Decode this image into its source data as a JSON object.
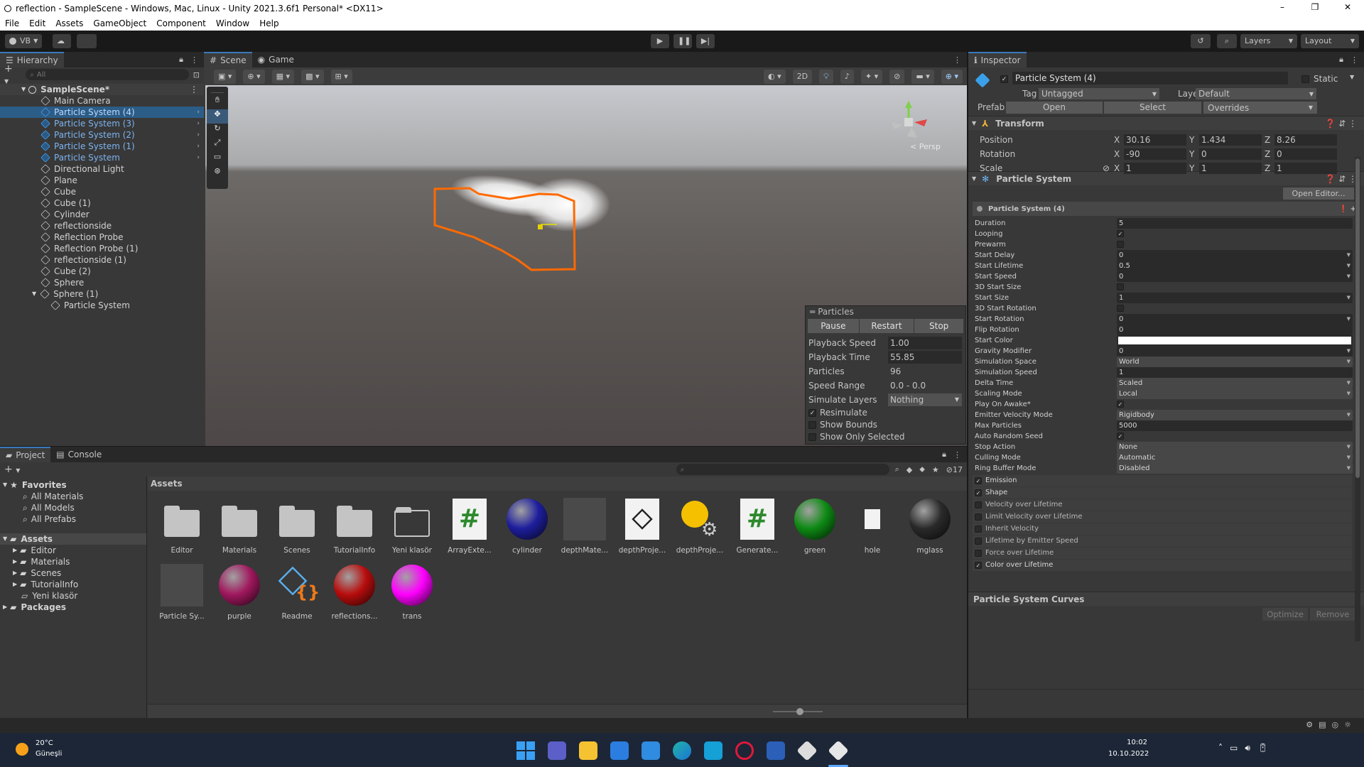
{
  "window": {
    "title": "reflection - SampleScene - Windows, Mac, Linux - Unity 2021.3.6f1 Personal* <DX11>"
  },
  "menu": [
    "File",
    "Edit",
    "Assets",
    "GameObject",
    "Component",
    "Window",
    "Help"
  ],
  "toolbar": {
    "account": "VB",
    "layers": "Layers",
    "layout": "Layout"
  },
  "hierarchy": {
    "tab": "Hierarchy",
    "search_placeholder": "All",
    "scene": "SampleScene*",
    "items": [
      {
        "label": "Main Camera",
        "indent": 1,
        "sel": false,
        "blue": false
      },
      {
        "label": "Particle System (4)",
        "indent": 1,
        "sel": true,
        "blue": true
      },
      {
        "label": "Particle System (3)",
        "indent": 1,
        "sel": false,
        "blue": true
      },
      {
        "label": "Particle System (2)",
        "indent": 1,
        "sel": false,
        "blue": true
      },
      {
        "label": "Particle System (1)",
        "indent": 1,
        "sel": false,
        "blue": true
      },
      {
        "label": "Particle System",
        "indent": 1,
        "sel": false,
        "blue": true
      },
      {
        "label": "Directional Light",
        "indent": 1,
        "sel": false,
        "blue": false
      },
      {
        "label": "Plane",
        "indent": 1,
        "sel": false,
        "blue": false
      },
      {
        "label": "Cube",
        "indent": 1,
        "sel": false,
        "blue": false
      },
      {
        "label": "Cube (1)",
        "indent": 1,
        "sel": false,
        "blue": false
      },
      {
        "label": "Cylinder",
        "indent": 1,
        "sel": false,
        "blue": false
      },
      {
        "label": "reflectionside",
        "indent": 1,
        "sel": false,
        "blue": false
      },
      {
        "label": "Reflection Probe",
        "indent": 1,
        "sel": false,
        "blue": false
      },
      {
        "label": "Reflection Probe (1)",
        "indent": 1,
        "sel": false,
        "blue": false
      },
      {
        "label": "reflectionside (1)",
        "indent": 1,
        "sel": false,
        "blue": false
      },
      {
        "label": "Cube (2)",
        "indent": 1,
        "sel": false,
        "blue": false
      },
      {
        "label": "Sphere",
        "indent": 1,
        "sel": false,
        "blue": false
      },
      {
        "label": "Sphere (1)",
        "indent": 1,
        "sel": false,
        "blue": false
      },
      {
        "label": "Particle System",
        "indent": 2,
        "sel": false,
        "blue": false
      }
    ]
  },
  "scene": {
    "tab_scene": "Scene",
    "tab_game": "Game",
    "btn_2d": "2D",
    "persp": "< Persp"
  },
  "particles_panel": {
    "title": "Particles",
    "pause": "Pause",
    "restart": "Restart",
    "stop": "Stop",
    "rows": [
      {
        "k": "Playback Speed",
        "v": "1.00"
      },
      {
        "k": "Playback Time",
        "v": "55.85"
      },
      {
        "k": "Particles",
        "v": "96"
      },
      {
        "k": "Speed Range",
        "v": "0.0 - 0.0"
      },
      {
        "k": "Simulate Layers",
        "v": "Nothing"
      }
    ],
    "resimulate": "Resimulate",
    "show_bounds": "Show Bounds",
    "show_only_selected": "Show Only Selected"
  },
  "inspector": {
    "tab": "Inspector",
    "object_name": "Particle System (4)",
    "static": "Static",
    "tag_label": "Tag",
    "tag": "Untagged",
    "layer_label": "Layer",
    "layer": "Default",
    "prefab_label": "Prefab",
    "open": "Open",
    "select": "Select",
    "overrides": "Overrides",
    "transform": {
      "title": "Transform",
      "position": "Position",
      "rotation": "Rotation",
      "scale": "Scale",
      "pos": [
        "30.16",
        "1.434",
        "8.26"
      ],
      "rot": [
        "-90",
        "0",
        "0"
      ],
      "scl": [
        "1",
        "1",
        "1"
      ],
      "axes": [
        "X",
        "Y",
        "Z"
      ]
    },
    "ps": {
      "title": "Particle System",
      "open_editor": "Open Editor...",
      "sub": "Particle System (4)",
      "props": [
        {
          "k": "Duration",
          "v": "5",
          "t": "text"
        },
        {
          "k": "Looping",
          "v": "✓",
          "t": "check"
        },
        {
          "k": "Prewarm",
          "v": "",
          "t": "check"
        },
        {
          "k": "Start Delay",
          "v": "0",
          "t": "drop"
        },
        {
          "k": "Start Lifetime",
          "v": "0.5",
          "t": "drop"
        },
        {
          "k": "Start Speed",
          "v": "0",
          "t": "drop"
        },
        {
          "k": "3D Start Size",
          "v": "",
          "t": "check"
        },
        {
          "k": "Start Size",
          "v": "1",
          "t": "drop"
        },
        {
          "k": "3D Start Rotation",
          "v": "",
          "t": "check"
        },
        {
          "k": "Start Rotation",
          "v": "0",
          "t": "drop"
        },
        {
          "k": "Flip Rotation",
          "v": "0",
          "t": "text"
        },
        {
          "k": "Start Color",
          "v": "",
          "t": "color"
        },
        {
          "k": "Gravity Modifier",
          "v": "0",
          "t": "drop"
        },
        {
          "k": "Simulation Space",
          "v": "World",
          "t": "drop"
        },
        {
          "k": "Simulation Speed",
          "v": "1",
          "t": "text"
        },
        {
          "k": "Delta Time",
          "v": "Scaled",
          "t": "drop"
        },
        {
          "k": "Scaling Mode",
          "v": "Local",
          "t": "drop"
        },
        {
          "k": "Play On Awake*",
          "v": "✓",
          "t": "check"
        },
        {
          "k": "Emitter Velocity Mode",
          "v": "Rigidbody",
          "t": "drop"
        },
        {
          "k": "Max Particles",
          "v": "5000",
          "t": "text"
        },
        {
          "k": "Auto Random Seed",
          "v": "✓",
          "t": "check"
        },
        {
          "k": "Stop Action",
          "v": "None",
          "t": "drop"
        },
        {
          "k": "Culling Mode",
          "v": "Automatic",
          "t": "drop"
        },
        {
          "k": "Ring Buffer Mode",
          "v": "Disabled",
          "t": "drop"
        }
      ],
      "modules": [
        {
          "k": "Emission",
          "on": true
        },
        {
          "k": "Shape",
          "on": true
        },
        {
          "k": "Velocity over Lifetime",
          "on": false
        },
        {
          "k": "Limit Velocity over Lifetime",
          "on": false
        },
        {
          "k": "Inherit Velocity",
          "on": false
        },
        {
          "k": "Lifetime by Emitter Speed",
          "on": false
        },
        {
          "k": "Force over Lifetime",
          "on": false
        },
        {
          "k": "Color over Lifetime",
          "on": true
        }
      ]
    },
    "curves": "Particle System Curves",
    "optimize": "Optimize",
    "remove": "Remove"
  },
  "project": {
    "tab_project": "Project",
    "tab_console": "Console",
    "favorites": "Favorites",
    "fav_items": [
      "All Materials",
      "All Models",
      "All Prefabs"
    ],
    "assets_root": "Assets",
    "asset_folders": [
      "Editor",
      "Materials",
      "Scenes",
      "TutorialInfo",
      "Yeni klasör"
    ],
    "packages": "Packages",
    "breadcrumb": "Assets",
    "hidden_count": "17",
    "assets": [
      {
        "n": "Editor",
        "k": "folder"
      },
      {
        "n": "Materials",
        "k": "folder"
      },
      {
        "n": "Scenes",
        "k": "folder"
      },
      {
        "n": "TutorialInfo",
        "k": "folder"
      },
      {
        "n": "Yeni klasör",
        "k": "emptyfolder"
      },
      {
        "n": "ArrayExte...",
        "k": "script"
      },
      {
        "n": "cylinder",
        "k": "sphere",
        "c": "#1e1e9e"
      },
      {
        "n": "depthMate...",
        "k": "mat"
      },
      {
        "n": "depthProje...",
        "k": "unity"
      },
      {
        "n": "depthProje...",
        "k": "gear"
      },
      {
        "n": "Generate...",
        "k": "script"
      },
      {
        "n": "green",
        "k": "sphere",
        "c": "#0e8a14"
      },
      {
        "n": "hole",
        "k": "file"
      },
      {
        "n": "mglass",
        "k": "sphere",
        "c": "#2a2a2a"
      },
      {
        "n": "Particle Sy...",
        "k": "mat"
      },
      {
        "n": "purple",
        "k": "sphere",
        "c": "#a0185e"
      },
      {
        "n": "Readme",
        "k": "readme"
      },
      {
        "n": "reflections...",
        "k": "sphere",
        "c": "#b80d0d"
      },
      {
        "n": "trans",
        "k": "sphere",
        "c": "#ff00ff"
      }
    ]
  },
  "taskbar": {
    "temp": "20°C",
    "weather": "Güneşli",
    "time": "10:02",
    "date": "10.10.2022"
  }
}
